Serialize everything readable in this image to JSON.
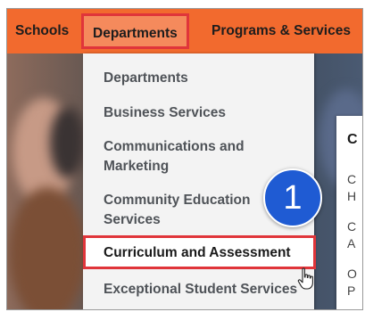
{
  "nav": {
    "items": [
      {
        "label": "Schools"
      },
      {
        "label": "Departments"
      },
      {
        "label": "Programs & Services"
      }
    ]
  },
  "dropdown": {
    "items": [
      {
        "label": "Departments"
      },
      {
        "label": "Business Services"
      },
      {
        "label": "Communications and Marketing"
      },
      {
        "label": "Community Education Services"
      },
      {
        "label": "Curriculum and Assessment"
      },
      {
        "label": "Exceptional Student Services"
      }
    ]
  },
  "submenu": {
    "title": "C",
    "lines": [
      "C",
      "H",
      "C",
      "A",
      "O",
      "P"
    ]
  },
  "badge": {
    "number": "1",
    "color": "#1f5bd3"
  },
  "colors": {
    "nav_bg": "#f26a2e",
    "highlight_border": "#e0353a",
    "dropdown_bg": "#f3f3f3"
  },
  "cursor": {
    "icon": "hand-pointer-icon"
  }
}
